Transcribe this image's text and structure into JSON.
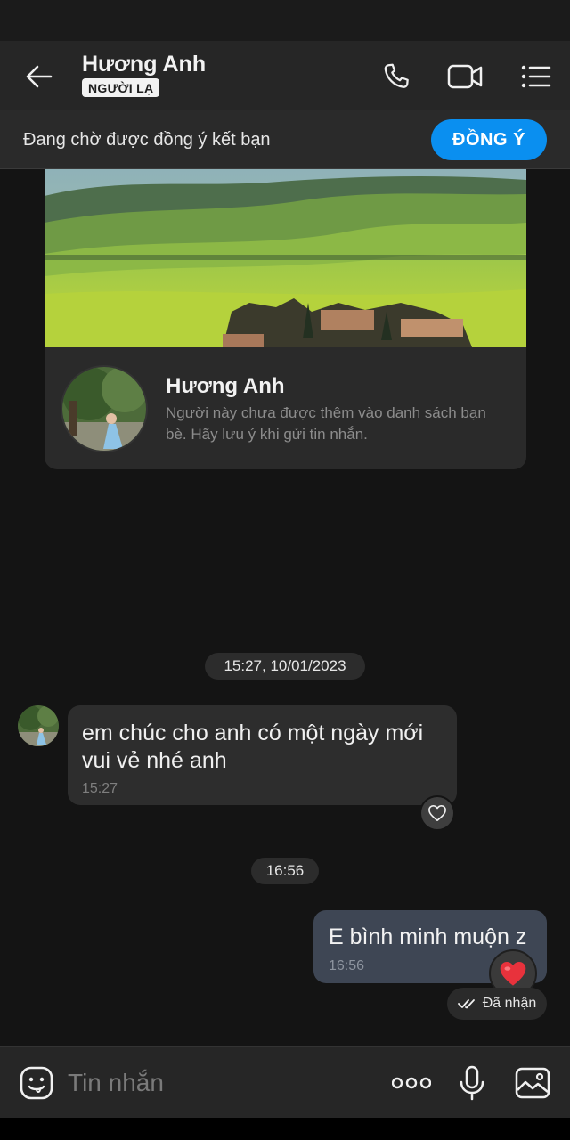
{
  "header": {
    "contact_name": "Hương Anh",
    "badge": "NGƯỜI LẠ",
    "icons": [
      "back-arrow-icon",
      "phone-icon",
      "video-call-icon",
      "menu-list-icon"
    ]
  },
  "pending": {
    "text": "Đang chờ được đồng ý kết bạn",
    "accept_label": "ĐỒNG Ý"
  },
  "profile_card": {
    "name": "Hương Anh",
    "note": "Người này chưa được thêm vào danh sách bạn bè. Hãy lưu ý khi gửi tin nhắn."
  },
  "messages": [
    {
      "date_chip": "15:27, 10/01/2023",
      "direction": "incoming",
      "text": "em chúc cho anh có một ngày mới vui vẻ nhé anh",
      "time": "15:27",
      "reaction_icon": "heart-outline-icon"
    },
    {
      "date_chip": "16:56",
      "direction": "outgoing",
      "text": "E bình minh muộn z",
      "time": "16:56",
      "reaction_icon": "red-heart-icon",
      "status": "Đã nhận"
    }
  ],
  "composer": {
    "placeholder": "Tin nhắn",
    "icons": [
      "sticker-icon",
      "more-dots-icon",
      "microphone-icon",
      "image-icon"
    ]
  },
  "colors": {
    "background": "#141414",
    "header": "#262626",
    "accent": "#0a8ff0",
    "bubble_in": "#2d2d2d",
    "bubble_out": "#3e4654",
    "love": "#e8323c"
  }
}
